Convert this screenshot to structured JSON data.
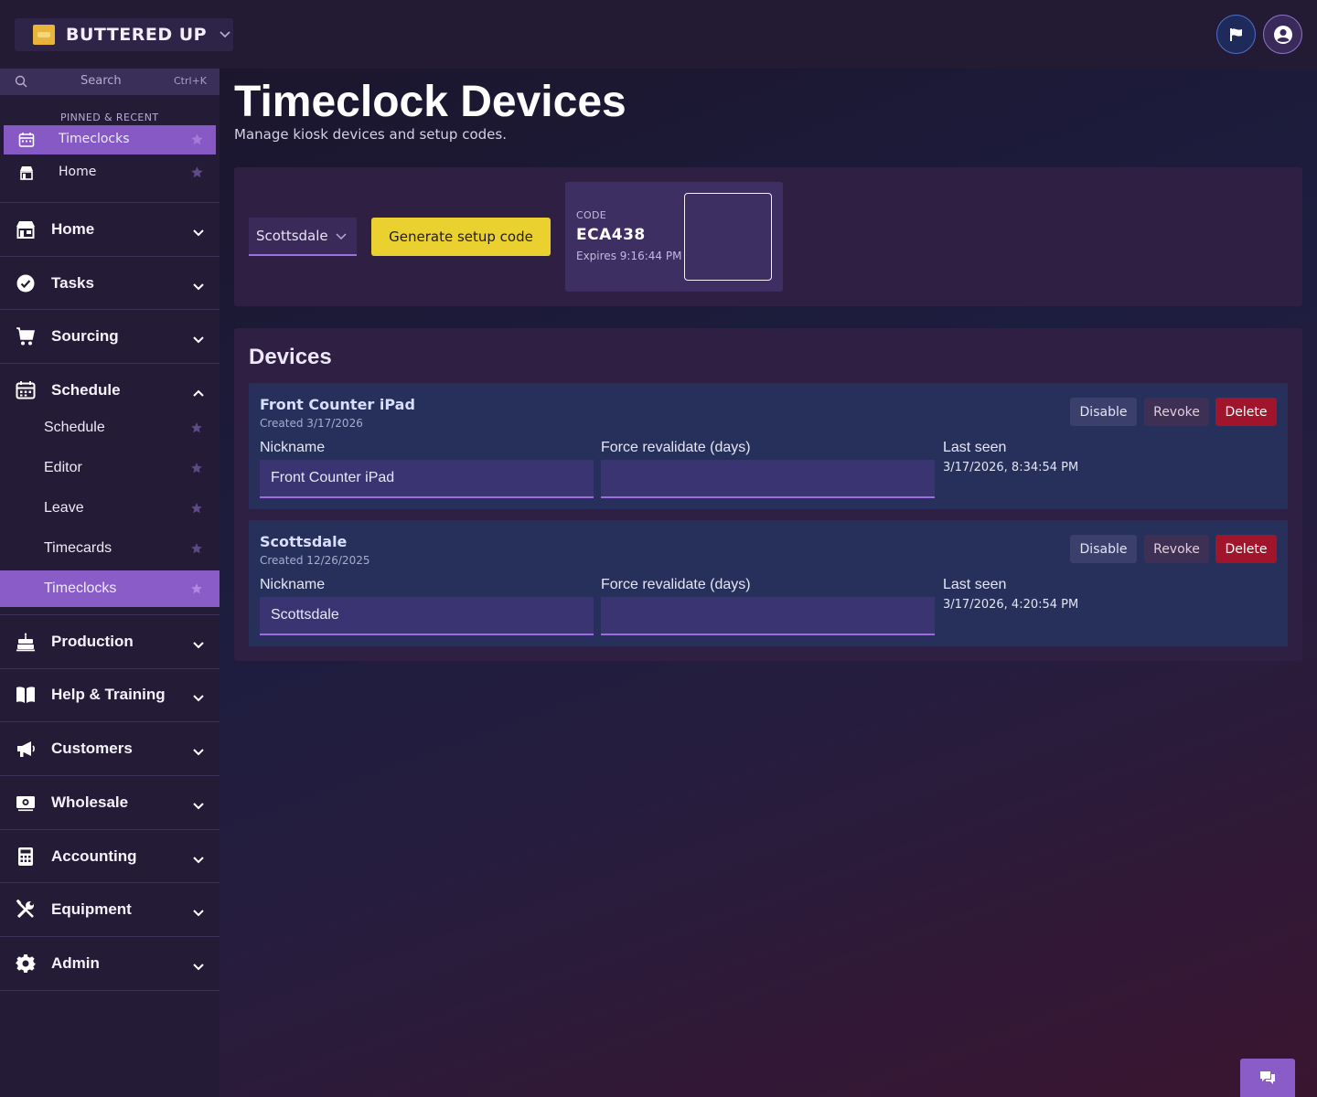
{
  "brand": {
    "name": "BUTTERED UP"
  },
  "search": {
    "placeholder": "Search",
    "shortcut": "Ctrl+K"
  },
  "pinned": {
    "label": "PINNED & RECENT",
    "items": [
      {
        "label": "Timeclocks",
        "icon": "calendar-icon",
        "active": true
      },
      {
        "label": "Home",
        "icon": "store-icon",
        "active": false
      }
    ]
  },
  "nav": {
    "items": [
      {
        "label": "Home",
        "icon": "store-icon",
        "expanded": false
      },
      {
        "label": "Tasks",
        "icon": "check-circle-icon",
        "expanded": false
      },
      {
        "label": "Sourcing",
        "icon": "cart-icon",
        "expanded": false
      },
      {
        "label": "Schedule",
        "icon": "calendar-icon",
        "expanded": true,
        "children": [
          "Schedule",
          "Editor",
          "Leave",
          "Timecards",
          "Timeclocks"
        ]
      },
      {
        "label": "Production",
        "icon": "cake-icon",
        "expanded": false
      },
      {
        "label": "Help & Training",
        "icon": "book-icon",
        "expanded": false
      },
      {
        "label": "Customers",
        "icon": "megaphone-icon",
        "expanded": false
      },
      {
        "label": "Wholesale",
        "icon": "money-icon",
        "expanded": false
      },
      {
        "label": "Accounting",
        "icon": "calculator-icon",
        "expanded": false
      },
      {
        "label": "Equipment",
        "icon": "tools-icon",
        "expanded": false
      },
      {
        "label": "Admin",
        "icon": "gear-icon",
        "expanded": false
      }
    ],
    "active_child": "Timeclocks"
  },
  "page": {
    "title": "Timeclock Devices",
    "subtitle": "Manage kiosk devices and setup codes."
  },
  "setup": {
    "location": "Scottsdale",
    "generate_label": "Generate setup code",
    "code_label": "CODE",
    "code": "ECA438",
    "expires": "Expires 9:16:44 PM"
  },
  "devices": {
    "title": "Devices",
    "col_nickname": "Nickname",
    "col_revalidate": "Force revalidate (days)",
    "col_lastseen": "Last seen",
    "btn_disable": "Disable",
    "btn_revoke": "Revoke",
    "btn_delete": "Delete",
    "items": [
      {
        "name": "Front Counter iPad",
        "created": "Created 3/17/2026",
        "nickname": "Front Counter iPad",
        "revalidate": "",
        "last_seen": "3/17/2026, 8:34:54 PM"
      },
      {
        "name": "Scottsdale",
        "created": "Created 12/26/2025",
        "nickname": "Scottsdale",
        "revalidate": "",
        "last_seen": "3/17/2026, 4:20:54 PM"
      }
    ]
  },
  "colors": {
    "accent": "#8a5cc8",
    "generate": "#ead12f",
    "delete": "#a0152b"
  }
}
